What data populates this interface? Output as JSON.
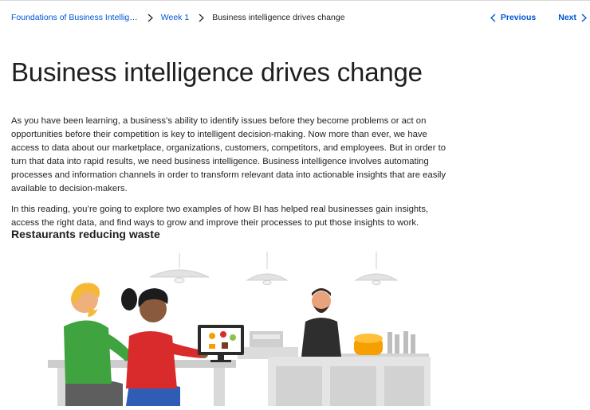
{
  "breadcrumb": {
    "course": "Foundations of Business Intellig…",
    "week": "Week 1",
    "current": "Business intelligence drives change"
  },
  "pager": {
    "previous": "Previous",
    "next": "Next"
  },
  "page_title": "Business intelligence drives change",
  "paragraphs": [
    "As you have been learning, a business’s ability to identify issues before they become problems or act on opportunities before their competition is key to intelligent decision-making. Now more than ever, we have access to data about our marketplace, organizations, customers, competitors, and employees. But in order to turn that data into rapid results, we need business intelligence. Business intelligence involves automating processes and information channels in order to transform relevant data into actionable insights that are easily available to decision-makers.",
    "In this reading, you’re going to explore two examples of how BI has helped real businesses gain insights, access the right data, and find ways to grow and improve their processes to put those insights to work."
  ],
  "section_heading": "Restaurants reducing waste",
  "colors": {
    "link": "#0056d2",
    "text": "#1f1f1f",
    "illustration_gray": "#d6d6d6",
    "shirt_green": "#3fa33f",
    "shirt_red": "#d92b2b",
    "accent_orange": "#f5a000"
  }
}
